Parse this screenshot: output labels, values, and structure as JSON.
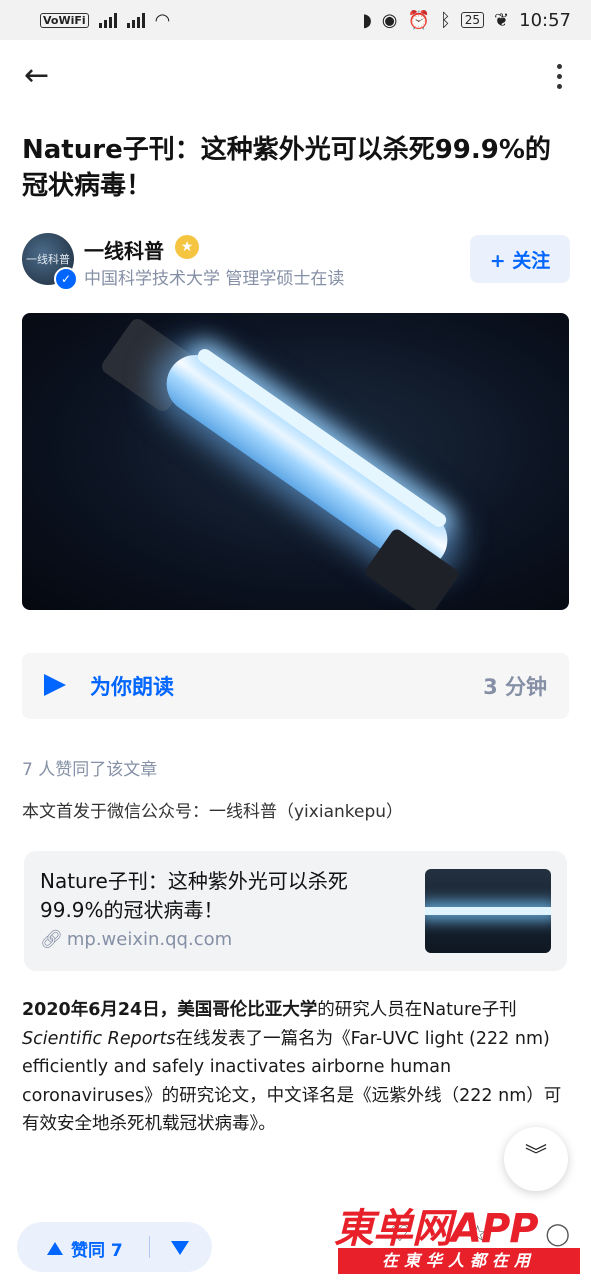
{
  "status_bar": {
    "network_label": "VoWiFi",
    "battery": "25",
    "time": "10:57"
  },
  "article": {
    "title": "Nature子刊：这种紫外光可以杀死99.9%的冠状病毒！",
    "author": {
      "name": "一线科普",
      "avatar_text": "一线科普",
      "description": "中国科学技术大学 管理学硕士在读",
      "follow_label": "+ 关注"
    },
    "reader": {
      "label": "为你朗读",
      "duration": "3 分钟"
    },
    "likes_text": "7 人赞同了该文章",
    "origin_text": "本文首发于微信公众号：一线科普（yixiankepu）",
    "link_card": {
      "title": "Nature子刊：这种紫外光可以杀死99.9%的冠状病毒！",
      "url": "mp.weixin.qq.com"
    },
    "paragraph": {
      "bold_date": "2020年6月24日，",
      "bold_univ": "美国哥伦比亚大学",
      "text1": "的研究人员在Nature子刊",
      "journal": "Scientific Reports",
      "text2": "在线发表了一篇名为《Far-UVC light (222 nm) efficiently and safely inactivates airborne human coronaviruses》的研究论文，中文译名是《远紫外线（222 nm）可有效安全地杀死机载冠状病毒》。"
    }
  },
  "bottom_bar": {
    "vote_label": "赞同 7"
  },
  "watermark": {
    "main": "東单网APP",
    "sub": "在東华人都在用"
  },
  "colors": {
    "accent": "#0066ff",
    "muted": "#8590a6",
    "watermark_red": "#e8202a"
  }
}
